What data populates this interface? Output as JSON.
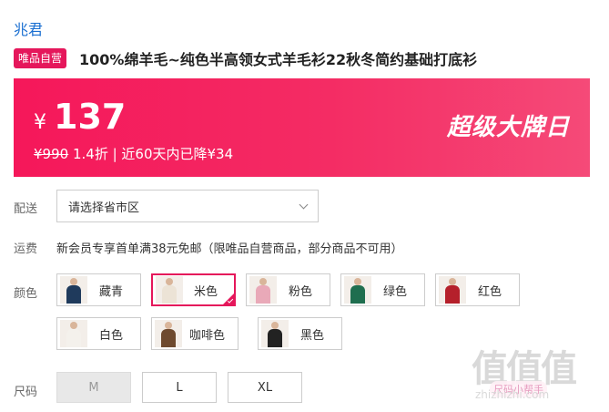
{
  "brand": "兆君",
  "product": {
    "tag": "唯品自营",
    "title": "100%绵羊毛~纯色半高领女式羊毛衫22秋冬简约基础打底衫"
  },
  "price": {
    "currency": "¥",
    "value": "137",
    "original": "¥990",
    "discount": "1.4折",
    "note": "| 近60天内已降¥34",
    "promo": "超级大牌日"
  },
  "delivery": {
    "label": "配送",
    "placeholder": "请选择省市区"
  },
  "shipping": {
    "label": "运费",
    "text": "新会员专享首单满38元免邮（限唯品自营商品，部分商品不可用）"
  },
  "color": {
    "label": "颜色",
    "options": [
      {
        "name": "藏青",
        "color": "#1f3a5c",
        "selected": false
      },
      {
        "name": "米色",
        "color": "#ece3d6",
        "selected": true
      },
      {
        "name": "粉色",
        "color": "#e9a9b8",
        "selected": false
      },
      {
        "name": "绿色",
        "color": "#1f6e4f",
        "selected": false
      },
      {
        "name": "红色",
        "color": "#b5202b",
        "selected": false
      },
      {
        "name": "白色",
        "color": "#f4f1ec",
        "selected": false
      },
      {
        "name": "咖啡色",
        "color": "#6e4a2f",
        "selected": false
      },
      {
        "name": "黑色",
        "color": "#222222",
        "selected": false
      }
    ]
  },
  "size": {
    "label": "尺码",
    "options": [
      {
        "name": "M",
        "disabled": true
      },
      {
        "name": "L",
        "disabled": false
      },
      {
        "name": "XL",
        "disabled": false
      }
    ]
  },
  "watermark": {
    "text": "值值值",
    "tag": "尺码小帮手",
    "url": "zhizhizhi.com"
  }
}
